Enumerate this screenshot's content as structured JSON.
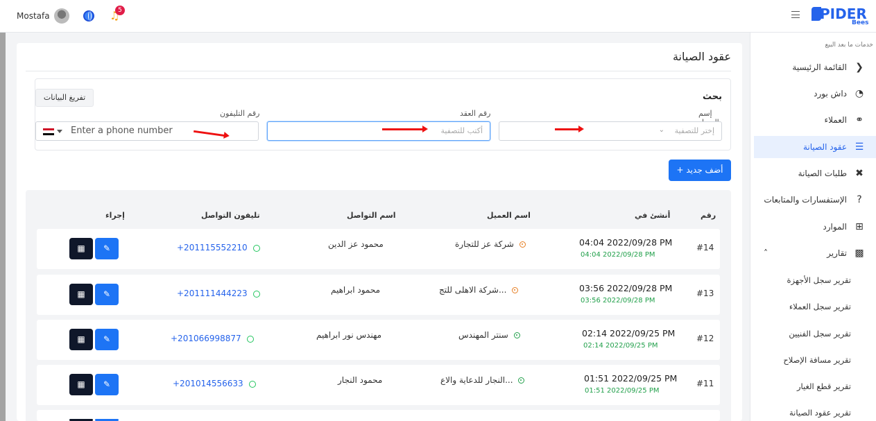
{
  "header": {
    "user_name": "Mostafa",
    "notifications_count": "5",
    "logo_text": "PIDER",
    "logo_sub": "Bees"
  },
  "sidebar": {
    "caption": "خدمات ما بعد البيع",
    "items": [
      {
        "label": "القائمة الرئيسية",
        "icon": "chevron-left-icon"
      },
      {
        "label": "داش بورد",
        "icon": "dashboard-icon"
      },
      {
        "label": "العملاء",
        "icon": "users-icon"
      },
      {
        "label": "عقود الصيانة",
        "icon": "list-icon"
      },
      {
        "label": "طلبات الصيانة",
        "icon": "tools-icon"
      },
      {
        "label": "الإستفسارات والمتابعات",
        "icon": "question-icon"
      },
      {
        "label": "الموارد",
        "icon": "resources-icon"
      },
      {
        "label": "تقارير",
        "icon": "reports-icon"
      }
    ],
    "subitems": [
      "تقرير سجل الأجهزة",
      "تقرير سجل العملاء",
      "تقرير سجل الفنيين",
      "تقرير مسافة الإصلاح",
      "تقرير قطع الغيار",
      "تقرير عقود الصيانة"
    ]
  },
  "page": {
    "title": "عقود الصيانة",
    "search_title": "بحث",
    "clear_label": "تفريغ البيانات",
    "client_label": "إسم العميل",
    "client_placeholder": "إختر للتصفية",
    "contract_label": "رقم العقد",
    "contract_placeholder": "أكتب للتصفية",
    "phone_label": "رقم التليفون",
    "phone_placeholder": "Enter a phone number",
    "add_label": "+ أضف جديد"
  },
  "table": {
    "headers": [
      "رقم",
      "أنشئ في",
      "اسم العميل",
      "اسم التواصل",
      "تليفون التواصل",
      "إجراء"
    ],
    "rows": [
      {
        "num": "#14",
        "created": "04:04 2022/09/28 PM",
        "updated": "04:04 2022/09/28 PM",
        "client": "شركة عز للتجارة",
        "client_status": "orange",
        "contact": "محمود عز الدين",
        "phone": "+201115552210"
      },
      {
        "num": "#13",
        "created": "03:56 2022/09/28 PM",
        "updated": "03:56 2022/09/28 PM",
        "client": "شركة الاهلى للتج...",
        "client_status": "orange",
        "contact": "محمود ابراهيم",
        "phone": "+201111444223"
      },
      {
        "num": "#12",
        "created": "02:14 2022/09/25 PM",
        "updated": "02:14 2022/09/25 PM",
        "client": "سنتر المهندس",
        "client_status": "green",
        "contact": "مهندس نور ابراهيم",
        "phone": "+201066998877"
      },
      {
        "num": "#11",
        "created": "01:51 2022/09/25 PM",
        "updated": "01:51 2022/09/25 PM",
        "client": "النجار للدعاية والاع...",
        "client_status": "green",
        "contact": "محمود النجار",
        "phone": "+201014556633"
      }
    ]
  },
  "colors": {
    "accent": "#1d74f5",
    "dark_action": "#0f172a",
    "success": "#22a04b"
  }
}
